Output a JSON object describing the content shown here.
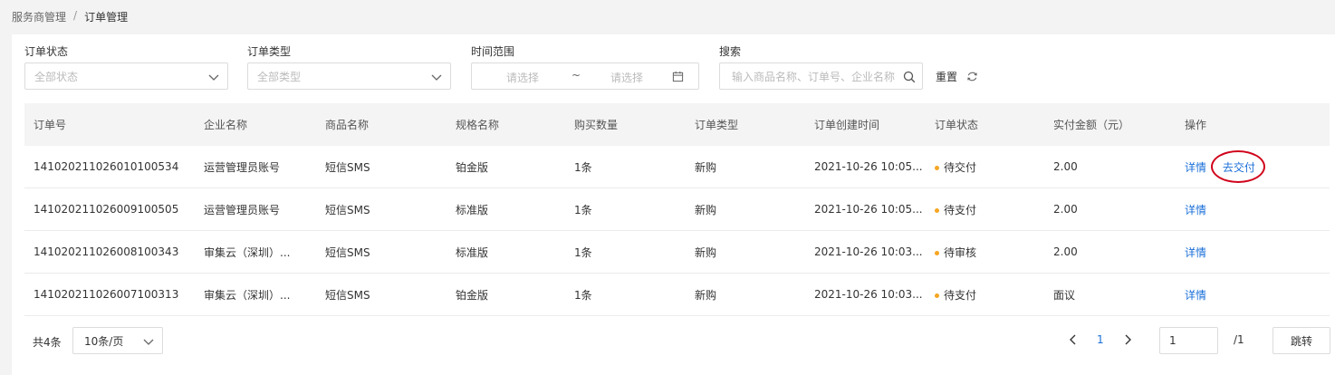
{
  "breadcrumb": {
    "parent": "服务商管理",
    "separator": "/",
    "current": "订单管理"
  },
  "filters": {
    "status": {
      "label": "订单状态",
      "placeholder": "全部状态"
    },
    "type": {
      "label": "订单类型",
      "placeholder": "全部类型"
    },
    "time": {
      "label": "时间范围",
      "start_placeholder": "请选择",
      "separator": "~",
      "end_placeholder": "请选择"
    },
    "search": {
      "label": "搜索",
      "placeholder": "输入商品名称、订单号、企业名称"
    },
    "reset_label": "重置"
  },
  "table": {
    "columns": [
      "订单号",
      "企业名称",
      "商品名称",
      "规格名称",
      "购买数量",
      "订单类型",
      "订单创建时间",
      "订单状态",
      "实付金额（元）",
      "操作"
    ],
    "rows": [
      {
        "order_no": "141020211026010100534",
        "company": "运营管理员账号",
        "product": "短信SMS",
        "spec": "铂金版",
        "qty": "1条",
        "type": "新购",
        "created": "2021-10-26 10:05...",
        "status": "待交付",
        "amount": "2.00",
        "action_detail": "详情",
        "action_extra": "去交付"
      },
      {
        "order_no": "141020211026009100505",
        "company": "运营管理员账号",
        "product": "短信SMS",
        "spec": "标准版",
        "qty": "1条",
        "type": "新购",
        "created": "2021-10-26 10:05...",
        "status": "待支付",
        "amount": "2.00",
        "action_detail": "详情"
      },
      {
        "order_no": "141020211026008100343",
        "company": "审集云（深圳）...",
        "product": "短信SMS",
        "spec": "标准版",
        "qty": "1条",
        "type": "新购",
        "created": "2021-10-26 10:03...",
        "status": "待审核",
        "amount": "2.00",
        "action_detail": "详情"
      },
      {
        "order_no": "141020211026007100313",
        "company": "审集云（深圳）...",
        "product": "短信SMS",
        "spec": "铂金版",
        "qty": "1条",
        "type": "新购",
        "created": "2021-10-26 10:03...",
        "status": "待支付",
        "amount": "面议",
        "action_detail": "详情"
      }
    ]
  },
  "pagination": {
    "total_label": "共4条",
    "page_size": "10条/页",
    "current_page": "1",
    "goto_value": "1",
    "total_pages": "/1",
    "goto_button": "跳转"
  },
  "colors": {
    "link": "#1a6fd8",
    "status_dot": "#f5a623",
    "highlight_circle": "#d0021b"
  }
}
